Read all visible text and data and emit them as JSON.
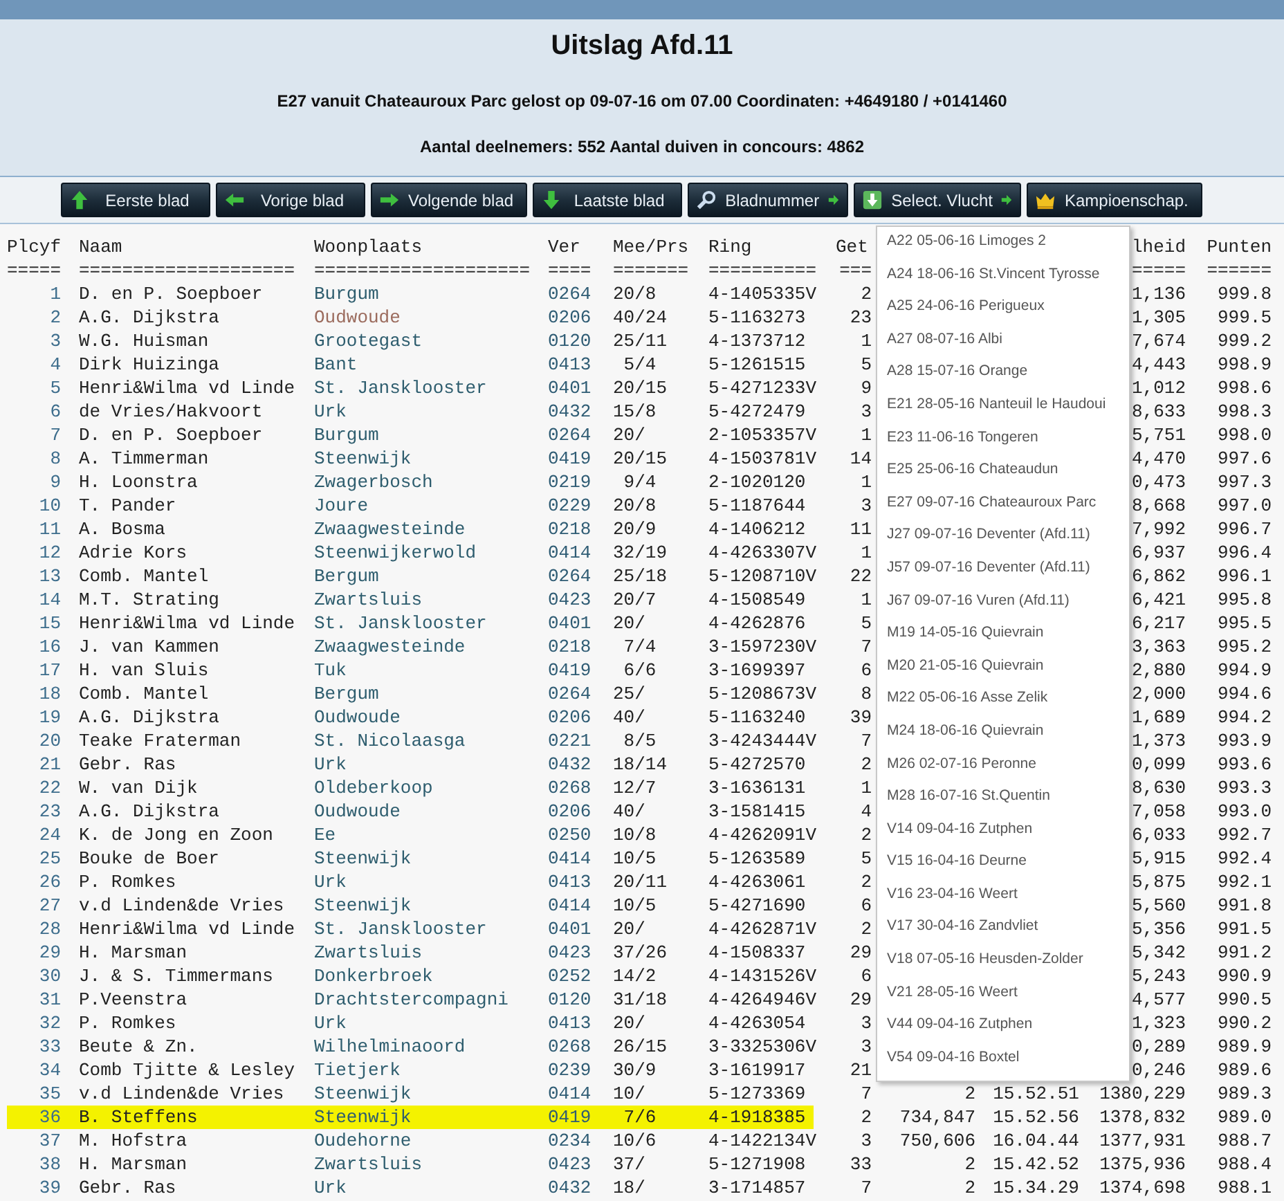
{
  "header": {
    "title": "Uitslag Afd.11",
    "flight_info": "E27 vanuit Chateauroux Parc gelost op 09-07-16 om 07.00 Coordinaten: +4649180 / +0141460",
    "participants": "Aantal deelnemers: 552 Aantal duiven in concours: 4862"
  },
  "toolbar": [
    {
      "label": "Eerste blad"
    },
    {
      "label": "Vorige blad"
    },
    {
      "label": "Volgende blad"
    },
    {
      "label": "Laatste blad"
    },
    {
      "label": "Bladnummer"
    },
    {
      "label": "Select. Vlucht"
    },
    {
      "label": "Kampioenschap."
    }
  ],
  "table": {
    "columns": {
      "plcyf": "Plcyf",
      "naam": "Naam",
      "woonplaats": "Woonplaats",
      "ver": "Ver",
      "mee_prs": "Mee/Prs",
      "ring": "Ring",
      "get": "Get",
      "snelheid": "lheid",
      "punten": "Punten"
    },
    "separators": {
      "plcyf": "=====",
      "naam": "====================",
      "woonplaats": "====================",
      "ver": "====",
      "mee_prs": "=======",
      "ring": "==========",
      "get": "===",
      "snelheid": "=====",
      "punten": "======"
    },
    "rows": [
      {
        "plcyf": "1",
        "naam": "D. en P. Soepboer",
        "woonplaats": "Burgum",
        "ver": "0264",
        "mee_prs": "20/8",
        "ring": "4-1405335V",
        "get": "2",
        "snelheid": "1,136",
        "punten": "999.8",
        "visited": false,
        "highlighted": false
      },
      {
        "plcyf": "2",
        "naam": "A.G. Dijkstra",
        "woonplaats": "Oudwoude",
        "ver": "0206",
        "mee_prs": "40/24",
        "ring": "5-1163273",
        "get": "23",
        "snelheid": "1,305",
        "punten": "999.5",
        "visited": true,
        "highlighted": false
      },
      {
        "plcyf": "3",
        "naam": "W.G. Huisman",
        "woonplaats": "Grootegast",
        "ver": "0120",
        "mee_prs": "25/11",
        "ring": "4-1373712",
        "get": "1",
        "snelheid": "7,674",
        "punten": "999.2",
        "visited": false,
        "highlighted": false
      },
      {
        "plcyf": "4",
        "naam": "Dirk Huizinga",
        "woonplaats": "Bant",
        "ver": "0413",
        "mee_prs": "5/4",
        "ring": "5-1261515",
        "get": "5",
        "snelheid": "4,443",
        "punten": "998.9",
        "visited": false,
        "highlighted": false
      },
      {
        "plcyf": "5",
        "naam": "Henri&Wilma vd Linde",
        "woonplaats": "St. Jansklooster",
        "ver": "0401",
        "mee_prs": "20/15",
        "ring": "5-4271233V",
        "get": "9",
        "snelheid": "1,012",
        "punten": "998.6",
        "visited": false,
        "highlighted": false
      },
      {
        "plcyf": "6",
        "naam": "de Vries/Hakvoort",
        "woonplaats": "Urk",
        "ver": "0432",
        "mee_prs": "15/8",
        "ring": "5-4272479",
        "get": "3",
        "snelheid": "8,633",
        "punten": "998.3",
        "visited": false,
        "highlighted": false
      },
      {
        "plcyf": "7",
        "naam": "D. en P. Soepboer",
        "woonplaats": "Burgum",
        "ver": "0264",
        "mee_prs": "20/",
        "ring": "2-1053357V",
        "get": "1",
        "snelheid": "5,751",
        "punten": "998.0",
        "visited": false,
        "highlighted": false
      },
      {
        "plcyf": "8",
        "naam": "A. Timmerman",
        "woonplaats": "Steenwijk",
        "ver": "0419",
        "mee_prs": "20/15",
        "ring": "4-1503781V",
        "get": "14",
        "snelheid": "4,470",
        "punten": "997.6",
        "visited": false,
        "highlighted": false
      },
      {
        "plcyf": "9",
        "naam": "H. Loonstra",
        "woonplaats": "Zwagerbosch",
        "ver": "0219",
        "mee_prs": "9/4",
        "ring": "2-1020120",
        "get": "1",
        "snelheid": "0,473",
        "punten": "997.3",
        "visited": false,
        "highlighted": false
      },
      {
        "plcyf": "10",
        "naam": "T. Pander",
        "woonplaats": "Joure",
        "ver": "0229",
        "mee_prs": "20/8",
        "ring": "5-1187644",
        "get": "3",
        "snelheid": "8,668",
        "punten": "997.0",
        "visited": false,
        "highlighted": false
      },
      {
        "plcyf": "11",
        "naam": "A. Bosma",
        "woonplaats": "Zwaagwesteinde",
        "ver": "0218",
        "mee_prs": "20/9",
        "ring": "4-1406212",
        "get": "11",
        "snelheid": "7,992",
        "punten": "996.7",
        "visited": false,
        "highlighted": false
      },
      {
        "plcyf": "12",
        "naam": "Adrie Kors",
        "woonplaats": "Steenwijkerwold",
        "ver": "0414",
        "mee_prs": "32/19",
        "ring": "4-4263307V",
        "get": "1",
        "snelheid": "6,937",
        "punten": "996.4",
        "visited": false,
        "highlighted": false
      },
      {
        "plcyf": "13",
        "naam": "Comb. Mantel",
        "woonplaats": "Bergum",
        "ver": "0264",
        "mee_prs": "25/18",
        "ring": "5-1208710V",
        "get": "22",
        "snelheid": "6,862",
        "punten": "996.1",
        "visited": false,
        "highlighted": false
      },
      {
        "plcyf": "14",
        "naam": "M.T. Strating",
        "woonplaats": "Zwartsluis",
        "ver": "0423",
        "mee_prs": "20/7",
        "ring": "4-1508549",
        "get": "1",
        "snelheid": "6,421",
        "punten": "995.8",
        "visited": false,
        "highlighted": false
      },
      {
        "plcyf": "15",
        "naam": "Henri&Wilma vd Linde",
        "woonplaats": "St. Jansklooster",
        "ver": "0401",
        "mee_prs": "20/",
        "ring": "4-4262876",
        "get": "5",
        "snelheid": "6,217",
        "punten": "995.5",
        "visited": false,
        "highlighted": false
      },
      {
        "plcyf": "16",
        "naam": "J. van Kammen",
        "woonplaats": "Zwaagwesteinde",
        "ver": "0218",
        "mee_prs": "7/4",
        "ring": "3-1597230V",
        "get": "7",
        "snelheid": "3,363",
        "punten": "995.2",
        "visited": false,
        "highlighted": false
      },
      {
        "plcyf": "17",
        "naam": "H. van Sluis",
        "woonplaats": "Tuk",
        "ver": "0419",
        "mee_prs": "6/6",
        "ring": "3-1699397",
        "get": "6",
        "snelheid": "2,880",
        "punten": "994.9",
        "visited": false,
        "highlighted": false
      },
      {
        "plcyf": "18",
        "naam": "Comb. Mantel",
        "woonplaats": "Bergum",
        "ver": "0264",
        "mee_prs": "25/",
        "ring": "5-1208673V",
        "get": "8",
        "snelheid": "2,000",
        "punten": "994.6",
        "visited": false,
        "highlighted": false
      },
      {
        "plcyf": "19",
        "naam": "A.G. Dijkstra",
        "woonplaats": "Oudwoude",
        "ver": "0206",
        "mee_prs": "40/",
        "ring": "5-1163240",
        "get": "39",
        "snelheid": "1,689",
        "punten": "994.2",
        "visited": false,
        "highlighted": false
      },
      {
        "plcyf": "20",
        "naam": "Teake Fraterman",
        "woonplaats": "St. Nicolaasga",
        "ver": "0221",
        "mee_prs": "8/5",
        "ring": "3-4243444V",
        "get": "7",
        "snelheid": "1,373",
        "punten": "993.9",
        "visited": false,
        "highlighted": false
      },
      {
        "plcyf": "21",
        "naam": "Gebr. Ras",
        "woonplaats": "Urk",
        "ver": "0432",
        "mee_prs": "18/14",
        "ring": "5-4272570",
        "get": "2",
        "snelheid": "0,099",
        "punten": "993.6",
        "visited": false,
        "highlighted": false
      },
      {
        "plcyf": "22",
        "naam": "W. van Dijk",
        "woonplaats": "Oldeberkoop",
        "ver": "0268",
        "mee_prs": "12/7",
        "ring": "3-1636131",
        "get": "1",
        "snelheid": "8,630",
        "punten": "993.3",
        "visited": false,
        "highlighted": false
      },
      {
        "plcyf": "23",
        "naam": "A.G. Dijkstra",
        "woonplaats": "Oudwoude",
        "ver": "0206",
        "mee_prs": "40/",
        "ring": "3-1581415",
        "get": "4",
        "snelheid": "7,058",
        "punten": "993.0",
        "visited": false,
        "highlighted": false
      },
      {
        "plcyf": "24",
        "naam": "K. de Jong en Zoon",
        "woonplaats": "Ee",
        "ver": "0250",
        "mee_prs": "10/8",
        "ring": "4-4262091V",
        "get": "2",
        "snelheid": "6,033",
        "punten": "992.7",
        "visited": false,
        "highlighted": false
      },
      {
        "plcyf": "25",
        "naam": "Bouke de Boer",
        "woonplaats": "Steenwijk",
        "ver": "0414",
        "mee_prs": "10/5",
        "ring": "5-1263589",
        "get": "5",
        "snelheid": "5,915",
        "punten": "992.4",
        "visited": false,
        "highlighted": false
      },
      {
        "plcyf": "26",
        "naam": "P. Romkes",
        "woonplaats": "Urk",
        "ver": "0413",
        "mee_prs": "20/11",
        "ring": "4-4263061",
        "get": "2",
        "snelheid": "5,875",
        "punten": "992.1",
        "visited": false,
        "highlighted": false
      },
      {
        "plcyf": "27",
        "naam": "v.d Linden&de Vries",
        "woonplaats": "Steenwijk",
        "ver": "0414",
        "mee_prs": "10/5",
        "ring": "5-4271690",
        "get": "6",
        "snelheid": "5,560",
        "punten": "991.8",
        "visited": false,
        "highlighted": false
      },
      {
        "plcyf": "28",
        "naam": "Henri&Wilma vd Linde",
        "woonplaats": "St. Jansklooster",
        "ver": "0401",
        "mee_prs": "20/",
        "ring": "4-4262871V",
        "get": "2",
        "snelheid": "5,356",
        "punten": "991.5",
        "visited": false,
        "highlighted": false
      },
      {
        "plcyf": "29",
        "naam": "H. Marsman",
        "woonplaats": "Zwartsluis",
        "ver": "0423",
        "mee_prs": "37/26",
        "ring": "4-1508337",
        "get": "29",
        "snelheid": "5,342",
        "punten": "991.2",
        "visited": false,
        "highlighted": false
      },
      {
        "plcyf": "30",
        "naam": "J. & S. Timmermans",
        "woonplaats": "Donkerbroek",
        "ver": "0252",
        "mee_prs": "14/2",
        "ring": "4-1431526V",
        "get": "6",
        "snelheid": "5,243",
        "punten": "990.9",
        "visited": false,
        "highlighted": false
      },
      {
        "plcyf": "31",
        "naam": "P.Veenstra",
        "woonplaats": "Drachtstercompagni",
        "ver": "0120",
        "mee_prs": "31/18",
        "ring": "4-4264946V",
        "get": "29",
        "snelheid": "4,577",
        "punten": "990.5",
        "visited": false,
        "highlighted": false
      },
      {
        "plcyf": "32",
        "naam": "P. Romkes",
        "woonplaats": "Urk",
        "ver": "0413",
        "mee_prs": "20/",
        "ring": "4-4263054",
        "get": "3",
        "snelheid": "1,323",
        "punten": "990.2",
        "visited": false,
        "highlighted": false
      },
      {
        "plcyf": "33",
        "naam": "Beute & Zn.",
        "woonplaats": "Wilhelminaoord",
        "ver": "0268",
        "mee_prs": "26/15",
        "ring": "3-3325306V",
        "get": "3",
        "snelheid": "0,289",
        "punten": "989.9",
        "visited": false,
        "highlighted": false
      },
      {
        "plcyf": "34",
        "naam": "Comb Tjitte & Lesley",
        "woonplaats": "Tietjerk",
        "ver": "0239",
        "mee_prs": "30/9",
        "ring": "3-1619917",
        "get": "21",
        "snelheid": "0,246",
        "punten": "989.6",
        "visited": false,
        "highlighted": false
      },
      {
        "plcyf": "35",
        "naam": "v.d Linden&de Vries",
        "woonplaats": "Steenwijk",
        "ver": "0414",
        "mee_prs": "10/",
        "ring": "5-1273369",
        "get": "7",
        "afstand": "2",
        "tijd": "15.52.51",
        "snelheid": "1380,229",
        "punten": "989.3",
        "visited": false,
        "highlighted": false
      },
      {
        "plcyf": "36",
        "naam": "B. Steffens",
        "woonplaats": "Steenwijk",
        "ver": "0419",
        "mee_prs": "7/6",
        "ring": "4-1918385",
        "get": "2",
        "afstand": "734,847",
        "tijd": "15.52.56",
        "snelheid": "1378,832",
        "punten": "989.0",
        "visited": false,
        "highlighted": true
      },
      {
        "plcyf": "37",
        "naam": "M. Hofstra",
        "woonplaats": "Oudehorne",
        "ver": "0234",
        "mee_prs": "10/6",
        "ring": "4-1422134V",
        "get": "3",
        "afstand": "750,606",
        "tijd": "16.04.44",
        "snelheid": "1377,931",
        "punten": "988.7",
        "visited": false,
        "highlighted": false
      },
      {
        "plcyf": "38",
        "naam": "H. Marsman",
        "woonplaats": "Zwartsluis",
        "ver": "0423",
        "mee_prs": "37/",
        "ring": "5-1271908",
        "get": "33",
        "afstand": "2",
        "tijd": "15.42.52",
        "snelheid": "1375,936",
        "punten": "988.4",
        "visited": false,
        "highlighted": false
      },
      {
        "plcyf": "39",
        "naam": "Gebr. Ras",
        "woonplaats": "Urk",
        "ver": "0432",
        "mee_prs": "18/",
        "ring": "3-1714857",
        "get": "7",
        "afstand": "2",
        "tijd": "15.34.29",
        "snelheid": "1374,698",
        "punten": "988.1",
        "visited": false,
        "highlighted": false
      }
    ]
  },
  "flight_menu": {
    "items": [
      "A22 05-06-16 Limoges 2",
      "A24 18-06-16 St.Vincent Tyrosse",
      "A25 24-06-16 Perigueux",
      "A27 08-07-16 Albi",
      "A28 15-07-16 Orange",
      "E21 28-05-16 Nanteuil le Haudoui",
      "E23 11-06-16 Tongeren",
      "E25 25-06-16 Chateaudun",
      "E27 09-07-16 Chateauroux Parc",
      "J27 09-07-16 Deventer (Afd.11)",
      "J57 09-07-16 Deventer (Afd.11)",
      "J67 09-07-16 Vuren (Afd.11)",
      "M19 14-05-16 Quievrain",
      "M20 21-05-16 Quievrain",
      "M22 05-06-16 Asse Zelik",
      "M24 18-06-16 Quievrain",
      "M26 02-07-16 Peronne",
      "M28 16-07-16 St.Quentin",
      "V14 09-04-16 Zutphen",
      "V15 16-04-16 Deurne",
      "V16 23-04-16 Weert",
      "V17 30-04-16 Zandvliet",
      "V18 07-05-16 Heusden-Zolder",
      "V21 28-05-16 Weert",
      "V44 09-04-16 Zutphen",
      "V54 09-04-16 Boxtel"
    ]
  }
}
